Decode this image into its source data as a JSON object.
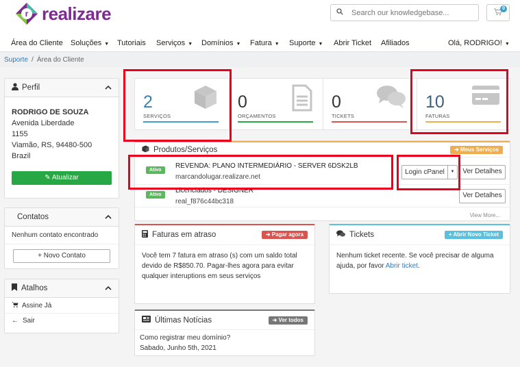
{
  "brand": {
    "name": "realizare"
  },
  "search": {
    "placeholder": "Search our knowledgebase..."
  },
  "cart": {
    "count": "0"
  },
  "nav": {
    "items": [
      {
        "label": "Área do Cliente",
        "caret": false
      },
      {
        "label": "Soluções",
        "caret": true
      },
      {
        "label": "Tutoriais",
        "caret": false
      },
      {
        "label": "Serviços",
        "caret": true
      },
      {
        "label": "Domínios",
        "caret": true
      },
      {
        "label": "Fatura",
        "caret": true
      },
      {
        "label": "Suporte",
        "caret": true
      },
      {
        "label": "Abrir Ticket",
        "caret": false
      },
      {
        "label": "Afiliados",
        "caret": false
      }
    ],
    "user": "Olá, RODRIGO!"
  },
  "breadcrumb": {
    "home": "Suporte",
    "sep": "/",
    "current": "Área do Cliente"
  },
  "profile": {
    "title": "Perfil",
    "name": "RODRIGO DE SOUZA",
    "address1": "Avenida Liberdade",
    "address2": "1155",
    "city": "Viamão, RS, 94480-500",
    "country": "Brazil",
    "update_label": "Atualizar"
  },
  "contacts": {
    "title": "Contatos",
    "empty": "Nenhum contato encontrado",
    "new_label": "+ Novo Contato"
  },
  "shortcuts": {
    "title": "Atalhos",
    "items": [
      "Assine Já",
      "Sair"
    ]
  },
  "stats": [
    {
      "value": "2",
      "label": "SERVIÇOS",
      "color": "#3e9fc9"
    },
    {
      "value": "0",
      "label": "ORÇAMENTOS",
      "color": "#28a745"
    },
    {
      "value": "0",
      "label": "TICKETS",
      "color": "#d9534f"
    },
    {
      "value": "10",
      "label": "FATURAS",
      "color": "#f0ad4e"
    }
  ],
  "products": {
    "title": "Produtos/Serviços",
    "my_services": "Meus Serviços",
    "status": "Ativo",
    "row1_name": "REVENDA: PLANO INTERMEDIÁRIO - SERVER 6DSK2LB",
    "row1_domain": "marcandolugar.realizare.net",
    "login_label": "Login cPanel",
    "details_label": "Ver Detalhes",
    "row2_name": "Licenciados - DESIGNER",
    "row2_domain": "real_f876c44bc318",
    "view_more": "View More..."
  },
  "invoices": {
    "title": "Faturas em atraso",
    "pay_now": "Pagar agora",
    "text": "Você tem 7 fatura em atraso (s) com um saldo total devido de R$850.70. Pagar-lhes agora para evitar qualquer interuptions em seus serviços"
  },
  "tickets": {
    "title": "Tickets",
    "open_new": "Abrir Novo Ticket",
    "text": "Nenhum ticket recente. Se você precisar de alguma ajuda, por favor ",
    "link": "Abrir ticket",
    "end": "."
  },
  "news": {
    "title": "Últimas Notícias",
    "view_all": "Ver todos",
    "headline": "Como registrar meu domínio?",
    "date": "Sabado, Junho 5th, 2021"
  },
  "colors": {
    "brand": "#7b2d8e",
    "green": "#28a745",
    "blue": "#3e9fc9",
    "red": "#d9534f",
    "orange": "#f0ad4e",
    "highlight": "#e8001c"
  }
}
